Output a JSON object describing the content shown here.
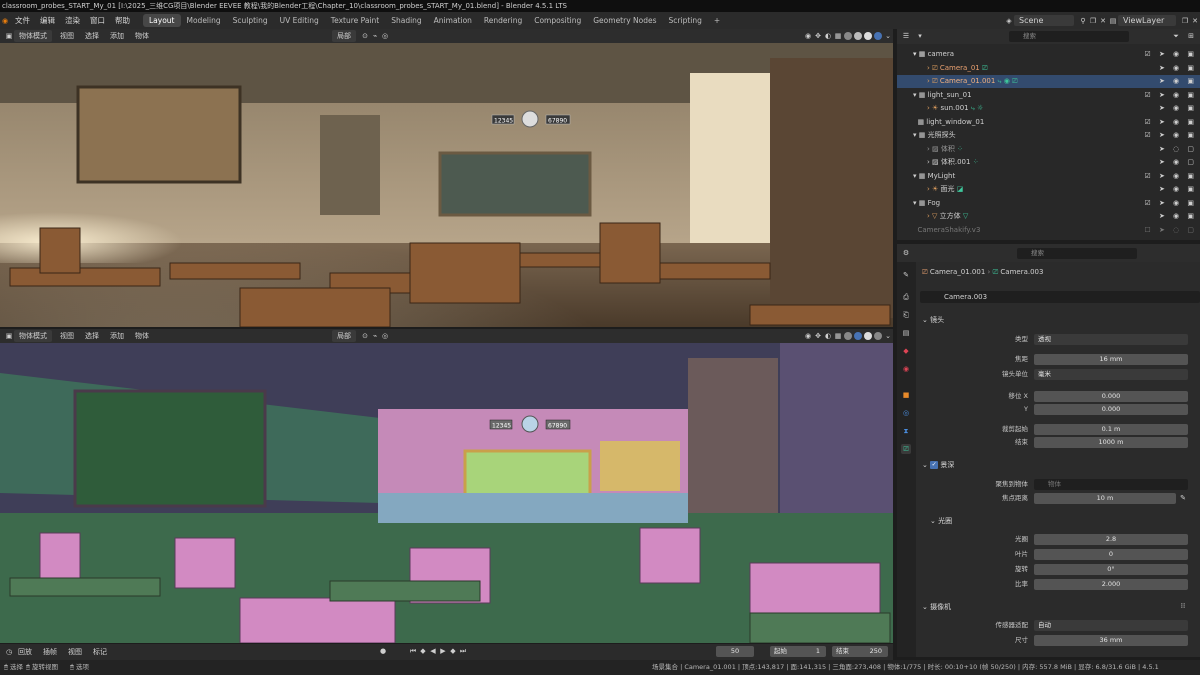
{
  "window": {
    "title": "classroom_probes_START_My_01 [I:\\2025_三维CG项目\\Blender EEVEE 教程\\我的Blender工程\\Chapter_10\\classroom_probes_START_My_01.blend] - Blender 4.5.1 LTS"
  },
  "menu": [
    "文件",
    "编辑",
    "渲染",
    "窗口",
    "帮助"
  ],
  "workspaces": [
    "Layout",
    "Modeling",
    "Sculpting",
    "UV Editing",
    "Texture Paint",
    "Shading",
    "Animation",
    "Rendering",
    "Compositing",
    "Geometry Nodes",
    "Scripting"
  ],
  "active_workspace": "Layout",
  "add_workspace": "+",
  "scene": {
    "scene_name": "Scene",
    "view_layer": "ViewLayer"
  },
  "viewport_header": {
    "mode": "物体模式",
    "view": "视图",
    "select": "选择",
    "add": "添加",
    "object": "物体",
    "transform": "局部"
  },
  "viewport_bottom_header": {
    "mode": "物体模式",
    "view": "视图",
    "select": "选择",
    "add": "添加",
    "object": "物体",
    "transform": "局部"
  },
  "board_numbers": {
    "left": "12345",
    "right": "67890"
  },
  "outliner": {
    "search_placeholder": "搜索",
    "rows": [
      {
        "name": "camera",
        "type": "collection"
      },
      {
        "name": "Camera_01",
        "type": "camera"
      },
      {
        "name": "Camera_01.001",
        "type": "camera",
        "selected": true
      },
      {
        "name": "light_sun_01",
        "type": "collection"
      },
      {
        "name": "sun.001",
        "type": "light"
      },
      {
        "name": "light_window_01",
        "type": "collection"
      },
      {
        "name": "光照探头",
        "type": "collection"
      },
      {
        "name": "体积",
        "type": "probe"
      },
      {
        "name": "体积.001",
        "type": "probe"
      },
      {
        "name": "MyLight",
        "type": "collection"
      },
      {
        "name": "面光",
        "type": "light"
      },
      {
        "name": "Fog",
        "type": "collection"
      },
      {
        "name": "立方体",
        "type": "mesh"
      },
      {
        "name": "CameraShakify.v3",
        "type": "collection"
      }
    ]
  },
  "properties": {
    "search_placeholder": "搜索",
    "breadcrumb": {
      "object": "Camera_01.001",
      "data": "Camera.003"
    },
    "datablock": "Camera.003",
    "lens": {
      "section": "镜头",
      "type_label": "类型",
      "type_value": "透视",
      "focal_label": "焦距",
      "focal_value": "16 mm",
      "unit_label": "镜头单位",
      "unit_value": "毫米",
      "shift_x_label": "移位 X",
      "shift_x_value": "0.000",
      "shift_y_label": "Y",
      "shift_y_value": "0.000",
      "clip_start_label": "裁剪起始",
      "clip_start_value": "0.1 m",
      "clip_end_label": "结束",
      "clip_end_value": "1000 m"
    },
    "dof": {
      "section": "景深",
      "focus_object_label": "聚焦到物体",
      "focus_object_placeholder": "物体",
      "focus_distance_label": "焦点距离",
      "focus_distance_value": "10 m",
      "aperture_section": "光圈",
      "fstop_label": "光圈",
      "fstop_value": "2.8",
      "blades_label": "叶片",
      "blades_value": "0",
      "rotation_label": "旋转",
      "rotation_value": "0°",
      "ratio_label": "比率",
      "ratio_value": "2.000"
    },
    "camera": {
      "section": "摄像机",
      "sensor_fit_label": "传感器适配",
      "sensor_fit_value": "自动",
      "size_label": "尺寸",
      "size_value": "36 mm"
    }
  },
  "timeline": {
    "playback": "回放",
    "keying": "插帧",
    "view": "视图",
    "marker": "标记",
    "current_frame": "50",
    "start_label": "起始",
    "start_value": "1",
    "end_label": "结束",
    "end_value": "250"
  },
  "statusbar": {
    "left_items": [
      "选择",
      "旋转视图",
      "选项"
    ],
    "stats": "场景集合 | Camera_01.001 | 顶点:143,817 | 面:141,315 | 三角面:273,408 | 物体:1/775 | 时长: 00:10+10 (帧 50/250) | 内存: 557.8 MiB | 显存: 6.8/31.6 GiB | 4.5.1"
  },
  "colors": {
    "accent": "#4772b3",
    "selected_row": "#334b6e",
    "panel": "#2b2b2b",
    "dark": "#1d1d1d"
  }
}
